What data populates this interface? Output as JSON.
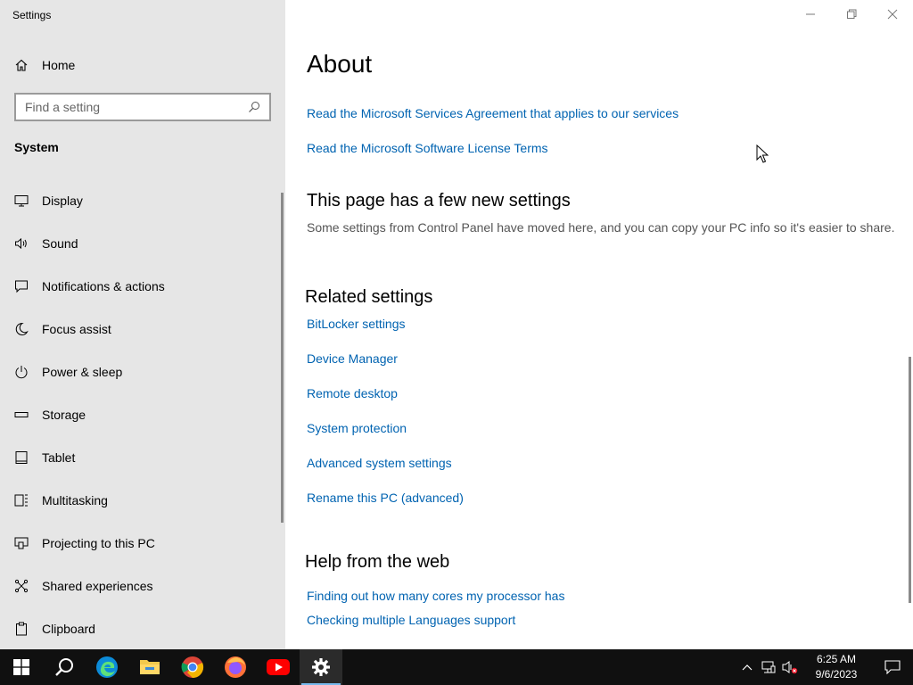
{
  "window": {
    "title": "Settings"
  },
  "sidebar": {
    "home_label": "Home",
    "search_placeholder": "Find a setting",
    "section_title": "System",
    "items": [
      {
        "label": "Display",
        "icon": "monitor-icon"
      },
      {
        "label": "Sound",
        "icon": "speaker-icon"
      },
      {
        "label": "Notifications & actions",
        "icon": "message-icon"
      },
      {
        "label": "Focus assist",
        "icon": "moon-icon"
      },
      {
        "label": "Power & sleep",
        "icon": "power-icon"
      },
      {
        "label": "Storage",
        "icon": "storage-icon"
      },
      {
        "label": "Tablet",
        "icon": "tablet-icon"
      },
      {
        "label": "Multitasking",
        "icon": "multitasking-icon"
      },
      {
        "label": "Projecting to this PC",
        "icon": "projecting-icon"
      },
      {
        "label": "Shared experiences",
        "icon": "shared-icon"
      },
      {
        "label": "Clipboard",
        "icon": "clipboard-icon"
      }
    ]
  },
  "main": {
    "title": "About",
    "links_top": [
      "Read the Microsoft Services Agreement that applies to our services",
      "Read the Microsoft Software License Terms"
    ],
    "new_settings": {
      "heading": "This page has a few new settings",
      "description": "Some settings from Control Panel have moved here, and you can copy your PC info so it's easier to share."
    },
    "related": {
      "heading": "Related settings",
      "links": [
        "BitLocker settings",
        "Device Manager",
        "Remote desktop",
        "System protection",
        "Advanced system settings",
        "Rename this PC (advanced)"
      ]
    },
    "help": {
      "heading": "Help from the web",
      "links": [
        "Finding out how many cores my processor has",
        "Checking multiple Languages support"
      ]
    }
  },
  "taskbar": {
    "apps": [
      "start-icon",
      "search-icon",
      "edge-icon",
      "file-explorer-icon",
      "chrome-icon",
      "firefox-icon",
      "youtube-icon",
      "settings-icon"
    ],
    "time": "6:25 AM",
    "date": "9/6/2023"
  },
  "colors": {
    "link": "#0063b1",
    "sidebar_bg": "#e6e6e6",
    "taskbar_bg": "#101010",
    "accent": "#76b9ed"
  }
}
